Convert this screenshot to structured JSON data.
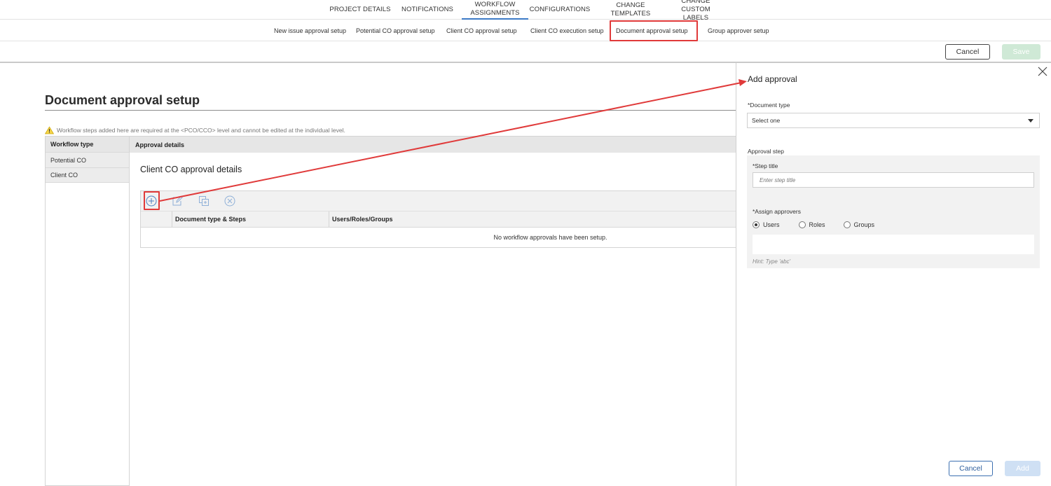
{
  "topnav": {
    "items": [
      {
        "label": "PROJECT DETAILS"
      },
      {
        "label": "NOTIFICATIONS"
      },
      {
        "label": "WORKFLOW ASSIGNMENTS"
      },
      {
        "label": "CONFIGURATIONS"
      },
      {
        "label": "CHANGE TEMPLATES"
      },
      {
        "label": "CHANGE CUSTOM LABELS"
      }
    ],
    "active": "WORKFLOW ASSIGNMENTS"
  },
  "subnav": {
    "items": [
      {
        "label": "New issue approval setup"
      },
      {
        "label": "Potential CO approval setup"
      },
      {
        "label": "Client CO approval setup"
      },
      {
        "label": "Client CO execution setup"
      },
      {
        "label": "Document approval setup"
      },
      {
        "label": "Group approver setup"
      }
    ],
    "active": "Document approval setup"
  },
  "actionbar": {
    "cancel_label": "Cancel",
    "save_label": "Save"
  },
  "main": {
    "title": "Document approval setup",
    "warning": "Workflow steps added here are required at the <PCO/CCO> level and cannot be edited at the individual level.",
    "workflow_type_header": "Workflow type",
    "workflow_types": [
      "Potential CO",
      "Client CO"
    ],
    "approval_details_header": "Approval details",
    "section_title": "Client CO approval details",
    "table": {
      "columns": [
        "",
        "Document type & Steps",
        "Users/Roles/Groups"
      ],
      "empty_message": "No workflow approvals have been setup."
    },
    "toolbar_icons": [
      "add-icon",
      "edit-icon",
      "copy-icon",
      "delete-icon"
    ]
  },
  "panel": {
    "title": "Add approval",
    "document_type_label": "*Document type",
    "document_type_value": "Select one",
    "approval_step_label": "Approval step",
    "step_title_label": "*Step title",
    "step_title_placeholder": "Enter step title",
    "assign_approvers_label": "*Assign approvers",
    "approver_options": [
      "Users",
      "Roles",
      "Groups"
    ],
    "approver_selected": "Users",
    "hint": "Hint: Type 'abc'",
    "cancel_label": "Cancel",
    "add_label": "Add"
  },
  "colors": {
    "accent": "#3c7ac6",
    "annotation": "#e03a3a",
    "save_disabled": "#cfe9d6",
    "add_disabled": "#cfe0f4"
  }
}
